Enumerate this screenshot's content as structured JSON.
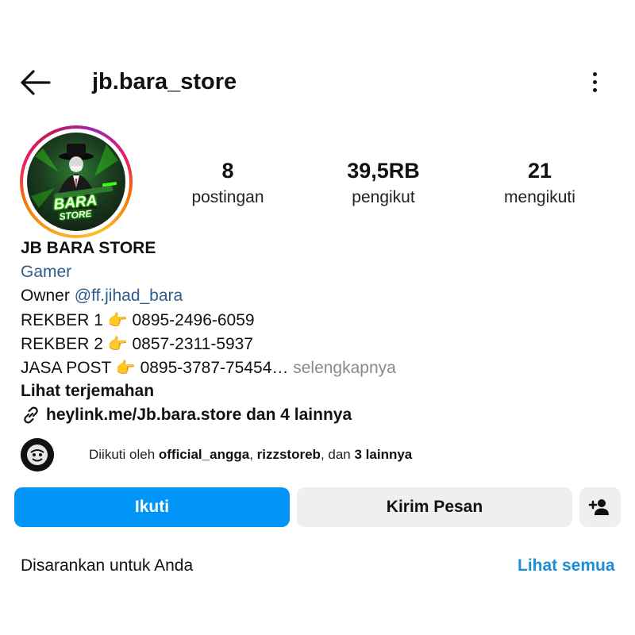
{
  "header": {
    "username": "jb.bara_store",
    "back_icon": "arrow-left-icon",
    "menu_icon": "more-vertical-icon"
  },
  "avatar": {
    "logo_line1": "BARA",
    "logo_line2": "STORE"
  },
  "stats": [
    {
      "value": "8",
      "label": "postingan"
    },
    {
      "value": "39,5RB",
      "label": "pengikut"
    },
    {
      "value": "21",
      "label": "mengikuti"
    }
  ],
  "bio": {
    "name": "JB BARA STORE",
    "category": "Gamer",
    "owner_prefix": "Owner ",
    "owner_handle": "@ff.jihad_bara",
    "lines": [
      {
        "label": "REKBER 1 ",
        "emoji": "👉",
        "number": " 0895-2496-6059"
      },
      {
        "label": "REKBER 2 ",
        "emoji": "👉",
        "number": " 0857-2311-5937"
      },
      {
        "label": "JASA POST  ",
        "emoji": "👉",
        "number": " 0895-3787-75454"
      }
    ],
    "ellipsis": "…",
    "more_label": " selengkapnya",
    "translate_label": "Lihat terjemahan",
    "link_text": "heylink.me/Jb.bara.store dan 4 lainnya",
    "link_icon": "link-icon"
  },
  "followed_by": {
    "prefix": "Diikuti oleh ",
    "user1": "official_angga",
    "separator": ", ",
    "user2": "rizzstoreb",
    "middle": ", dan ",
    "others": "3 lainnya"
  },
  "actions": {
    "follow_label": "Ikuti",
    "message_label": "Kirim Pesan",
    "add_icon": "add-user-icon"
  },
  "suggested": {
    "title": "Disarankan untuk Anda",
    "see_all": "Lihat semua"
  },
  "colors": {
    "follow_button": "#0095f6",
    "link_blue": "#2e5d8c",
    "see_all_blue": "#1a8fd8",
    "secondary_button": "#efefef"
  }
}
